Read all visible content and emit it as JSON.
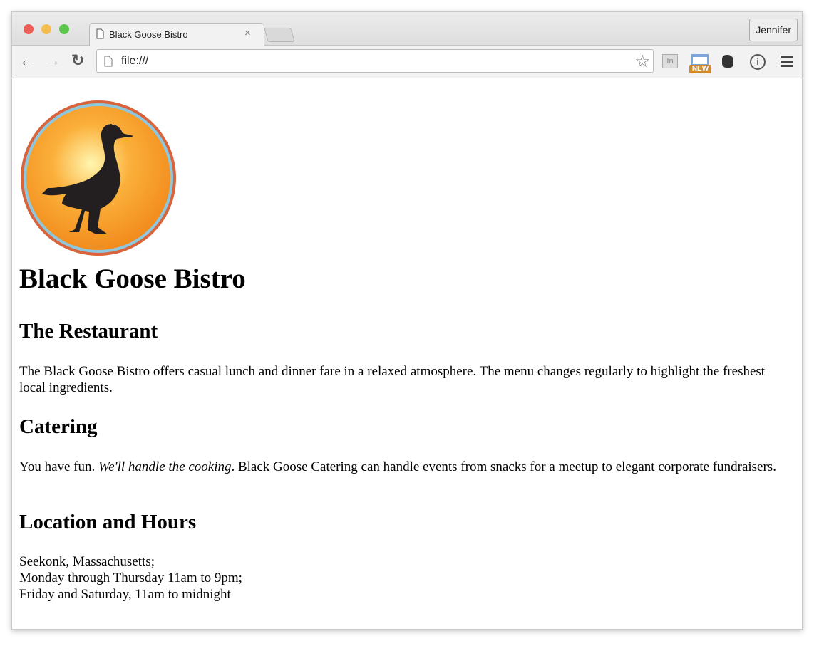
{
  "browser": {
    "tab_title": "Black Goose Bistro",
    "profile": "Jennifer",
    "url": "file:///",
    "extensions": [
      "in-icon",
      "new-badge-icon",
      "evernote-icon",
      "info-icon",
      "menu-icon"
    ],
    "new_badge": "NEW",
    "in_label": "In"
  },
  "page": {
    "title": "Black Goose Bistro",
    "sections": [
      {
        "heading": "The Restaurant",
        "text": "The Black Goose Bistro offers casual lunch and dinner fare in a relaxed atmosphere. The menu changes regularly to highlight the freshest local ingredients."
      },
      {
        "heading": "Catering",
        "text_before": "You have fun. ",
        "emphasis": "We'll handle the cooking",
        "text_after": ". Black Goose Catering can handle events from snacks for a meetup to elegant corporate fundraisers."
      },
      {
        "heading": "Location and Hours",
        "lines": [
          "Seekonk, Massachusetts;",
          "Monday through Thursday 11am to 9pm;",
          "Friday and Saturday, 11am to midnight"
        ]
      }
    ]
  }
}
